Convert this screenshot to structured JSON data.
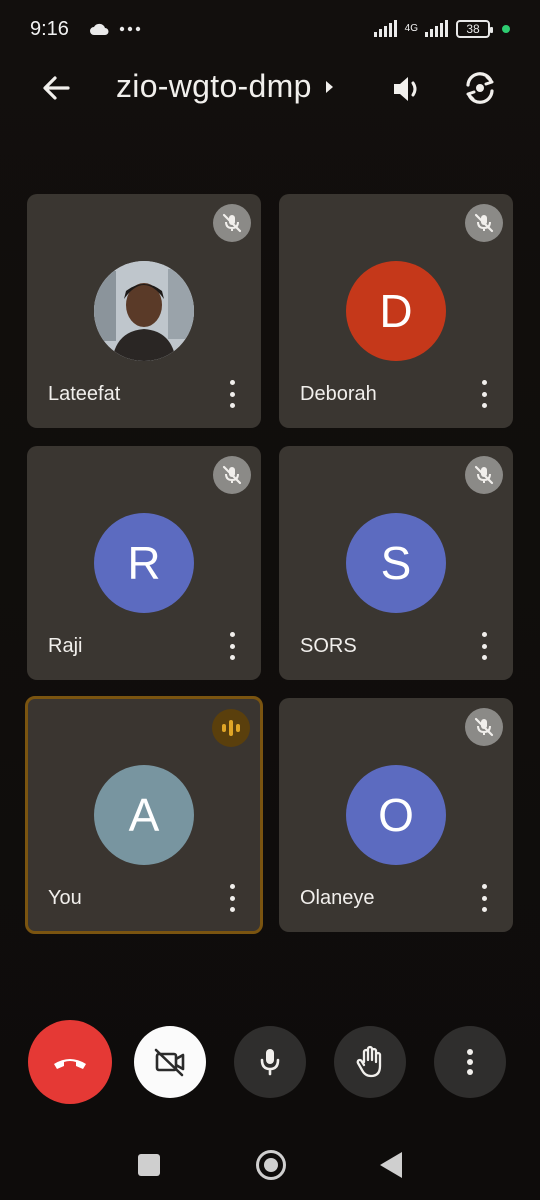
{
  "status_bar": {
    "time": "9:16",
    "network": "4G",
    "battery": "38"
  },
  "top_bar": {
    "meeting_code": "zio-wgto-dmp"
  },
  "participants": [
    {
      "name": "Lateefat",
      "initial": "",
      "has_photo": true,
      "muted": true,
      "speaking": false
    },
    {
      "name": "Deborah",
      "initial": "D",
      "color": "#c5381a",
      "muted": true,
      "speaking": false
    },
    {
      "name": "Raji",
      "initial": "R",
      "color": "#5c6bc0",
      "muted": true,
      "speaking": false
    },
    {
      "name": "SORS",
      "initial": "S",
      "color": "#5c6bc0",
      "muted": true,
      "speaking": false
    },
    {
      "name": "You",
      "initial": "A",
      "color": "#7895a0",
      "muted": false,
      "speaking": true
    },
    {
      "name": "Olaneye",
      "initial": "O",
      "color": "#5c6bc0",
      "muted": true,
      "speaking": false
    }
  ],
  "controls": {
    "end_call_icon": "phone-hangup-icon",
    "camera_icon": "camera-off-icon",
    "mic_icon": "mic-icon",
    "hand_icon": "raise-hand-icon",
    "more_icon": "more-vert-icon"
  },
  "colors": {
    "tile_bg": "#3a3631",
    "active_border": "#7a5410",
    "end_call": "#e53935"
  }
}
